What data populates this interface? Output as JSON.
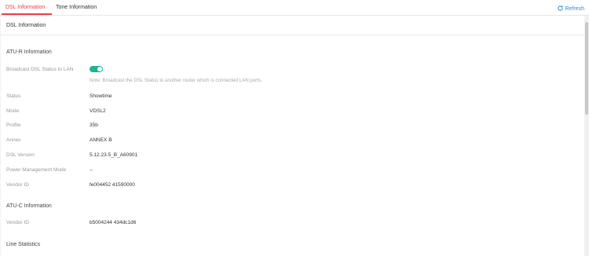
{
  "tabs": [
    {
      "label": "DSL Information"
    },
    {
      "label": "Tone Information"
    }
  ],
  "refresh_label": "Refresh",
  "panel_title": "DSL Information",
  "atur": {
    "title": "ATU-R Information",
    "broadcast_label": "Broadcast DSL Status to LAN",
    "broadcast_enabled": true,
    "note": "Note: Broadcast the DSL Status to another router which is connected LAN ports.",
    "rows": [
      {
        "label": "Status",
        "value": "Showtime"
      },
      {
        "label": "Mode",
        "value": "VDSL2"
      },
      {
        "label": "Profile",
        "value": "35b"
      },
      {
        "label": "Annex",
        "value": "ANNEX B"
      },
      {
        "label": "DSL Version",
        "value": "5.12.23.5_B_A60901"
      },
      {
        "label": "Power Management Mode",
        "value": "--"
      },
      {
        "label": "Vendor ID",
        "value": "fe004452 41590000"
      }
    ]
  },
  "atuc": {
    "title": "ATU-C Information",
    "rows": [
      {
        "label": "Vendor ID",
        "value": "b5004244 434dc1d6"
      }
    ]
  },
  "line_stats_title": "Line Statistics",
  "colors": {
    "accent_red": "#e8404a",
    "toggle_green": "#1db493",
    "link_blue": "#2f8bd8"
  }
}
